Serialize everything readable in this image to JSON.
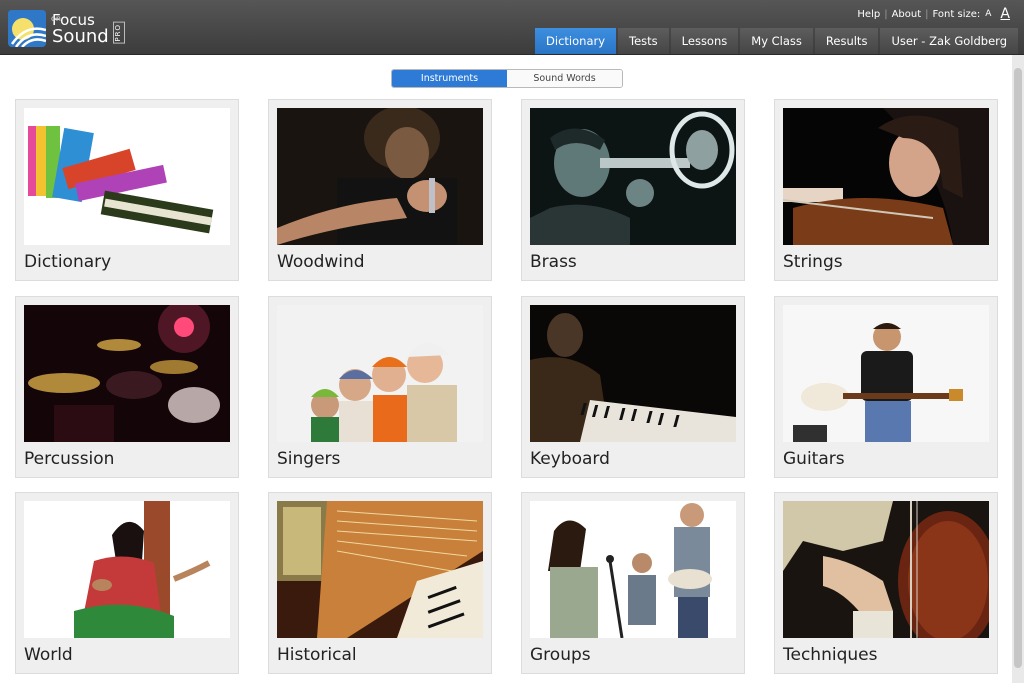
{
  "logo": {
    "focus": "Focus",
    "on": "on",
    "sound": "Sound",
    "pro": "PRO"
  },
  "util_links": {
    "help": "Help",
    "about": "About",
    "font_size_label": "Font size:",
    "font_small": "A",
    "font_large": "A"
  },
  "nav": {
    "tabs": [
      {
        "label": "Dictionary",
        "active": true
      },
      {
        "label": "Tests",
        "active": false
      },
      {
        "label": "Lessons",
        "active": false
      },
      {
        "label": "My Class",
        "active": false
      },
      {
        "label": "Results",
        "active": false
      },
      {
        "label": "User - Zak Goldberg",
        "active": false
      }
    ]
  },
  "toggle": {
    "instruments": "Instruments",
    "sound_words": "Sound Words",
    "selected": "Instruments"
  },
  "categories": [
    {
      "label": "Dictionary"
    },
    {
      "label": "Woodwind"
    },
    {
      "label": "Brass"
    },
    {
      "label": "Strings"
    },
    {
      "label": "Percussion"
    },
    {
      "label": "Singers"
    },
    {
      "label": "Keyboard"
    },
    {
      "label": "Guitars"
    },
    {
      "label": "World"
    },
    {
      "label": "Historical"
    },
    {
      "label": "Groups"
    },
    {
      "label": "Techniques"
    }
  ],
  "colors": {
    "accent": "#2d7bd6",
    "header": "#454545"
  }
}
